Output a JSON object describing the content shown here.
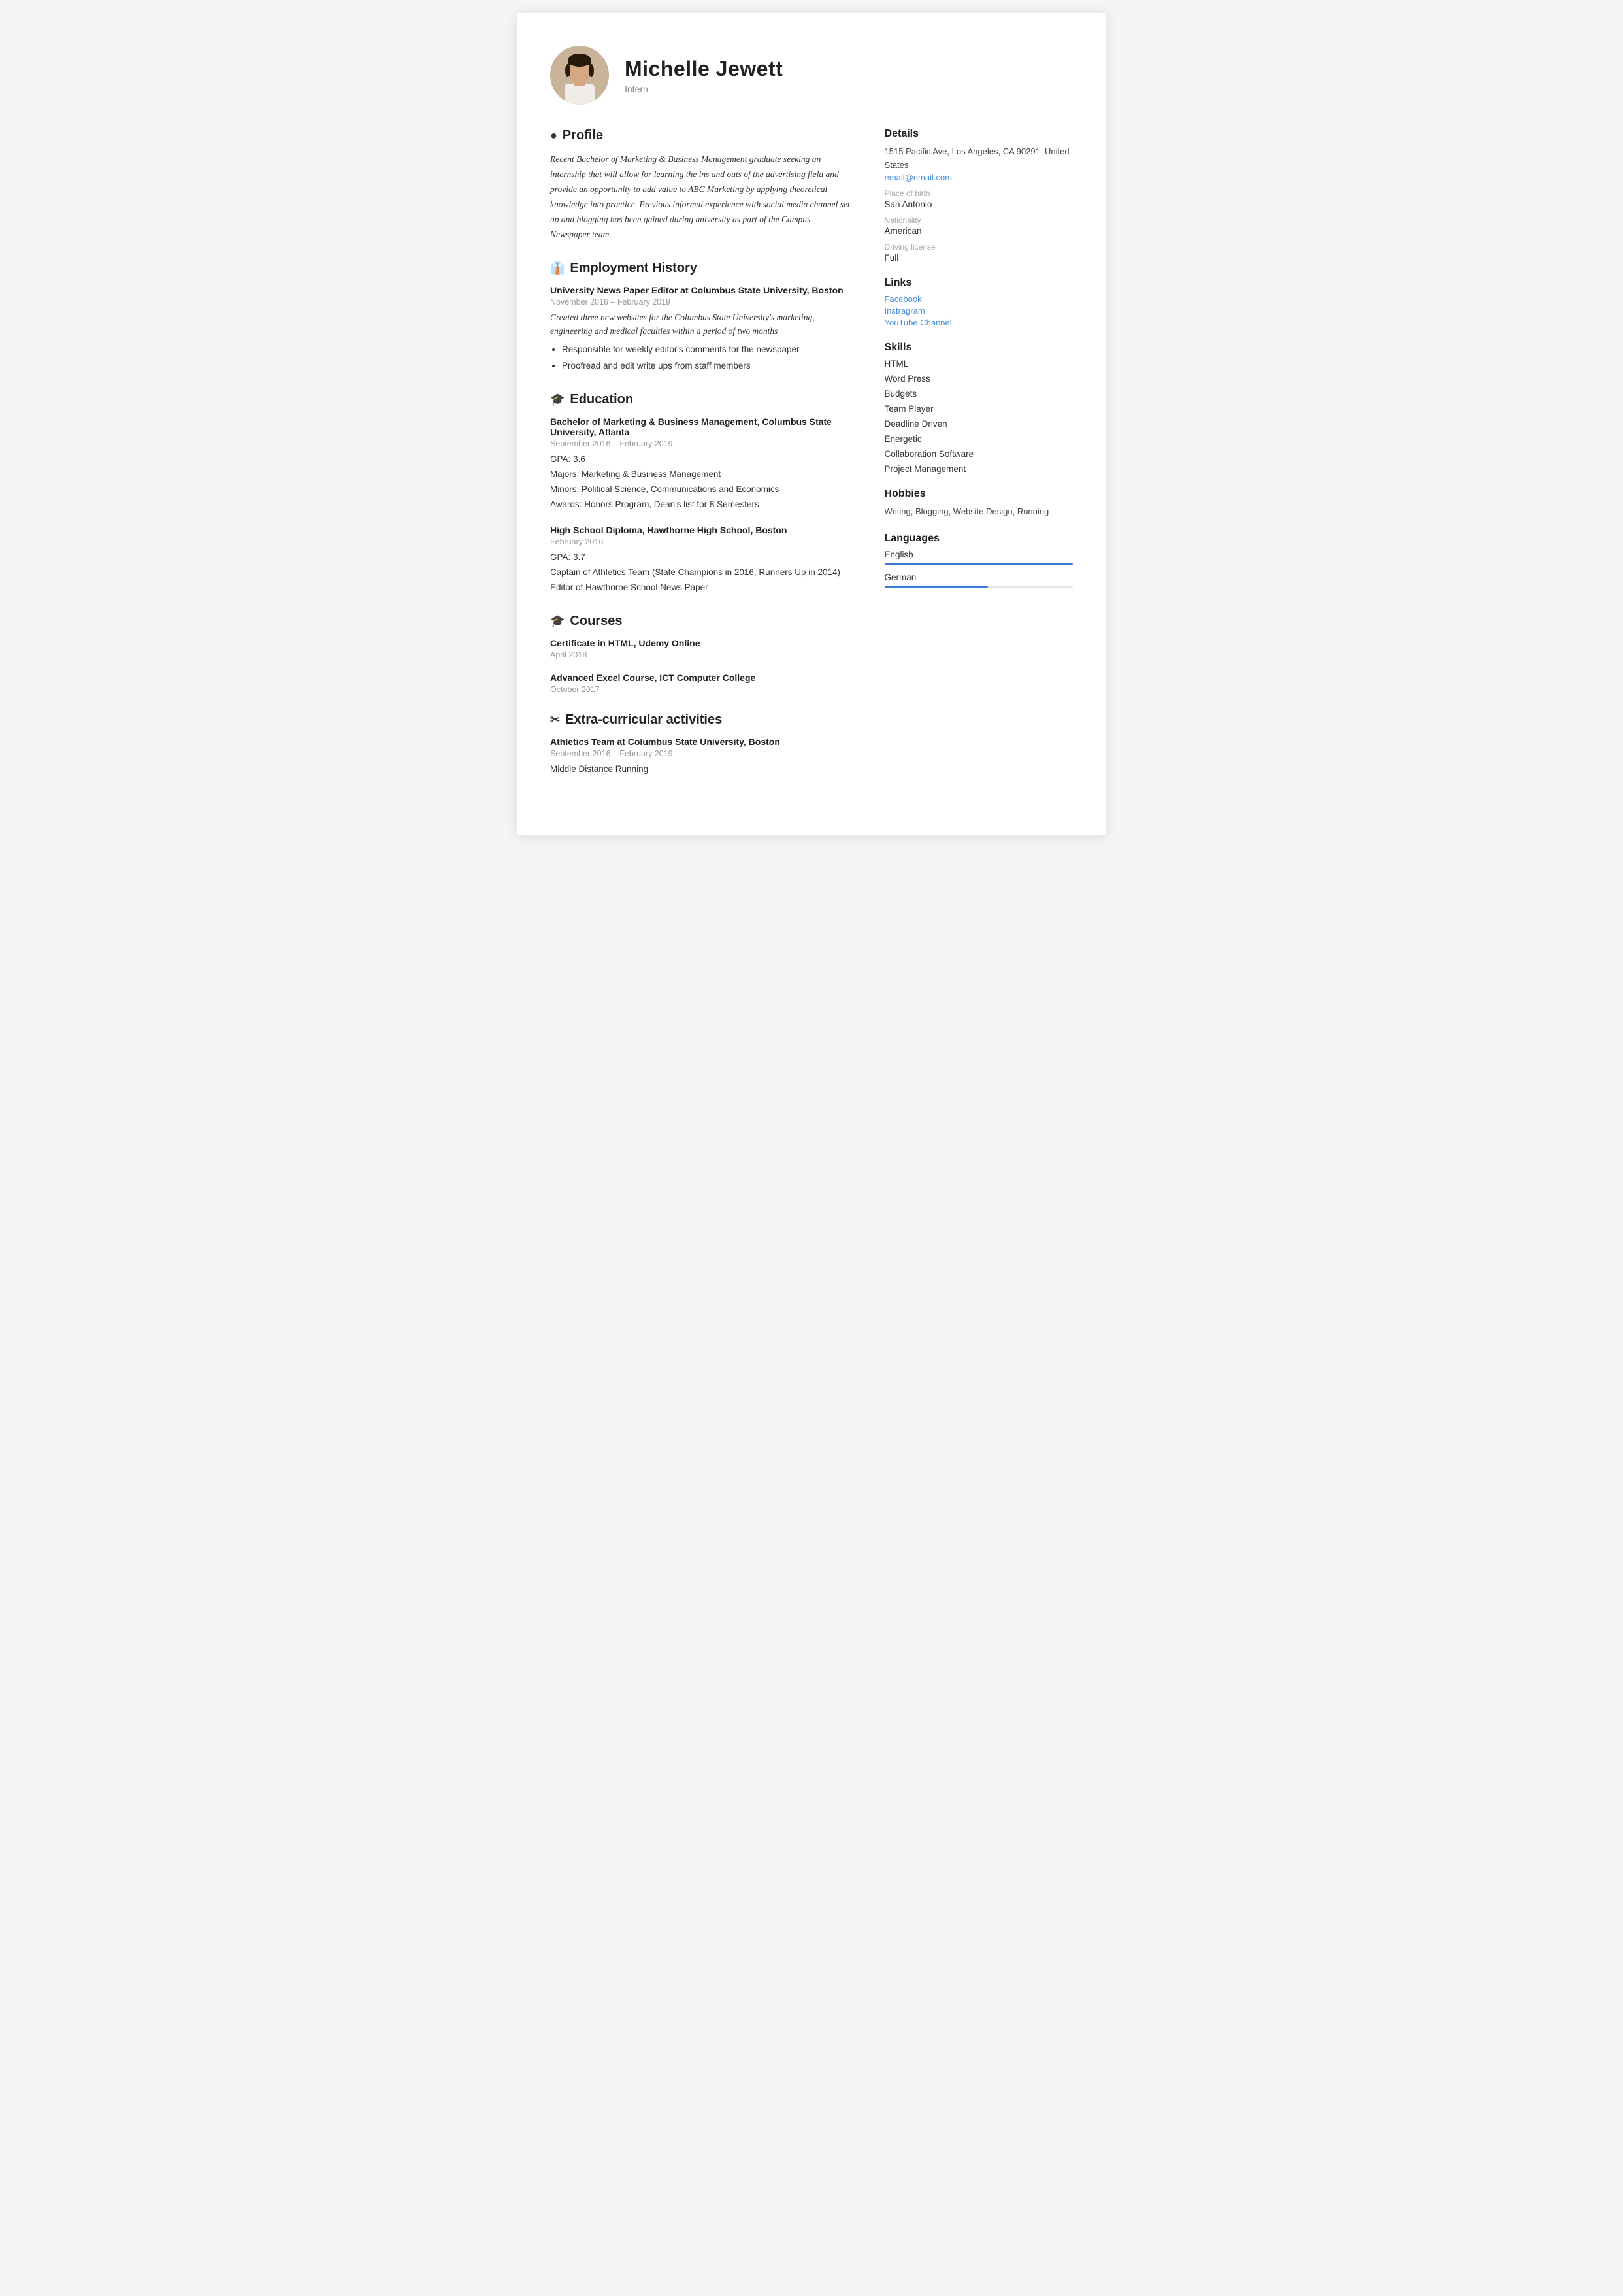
{
  "header": {
    "name": "Michelle Jewett",
    "title": "Intern"
  },
  "profile": {
    "section_label": "Profile",
    "icon": "👤",
    "text": "Recent Bachelor of Marketing & Business Management graduate seeking an internship that will allow for learning the ins and outs of the advertising field and provide an opportunity to add value to ABC Marketing by applying theoretical knowledge into practice. Previous informal experience with social media channel set up and blogging has been gained during university as part of the Campus Newspaper team."
  },
  "employment": {
    "section_label": "Employment History",
    "icon": "💼",
    "items": [
      {
        "title": "University News Paper Editor at Columbus State University, Boston",
        "date": "November 2016 – February 2019",
        "desc": "Created three new websites for the Columbus State University's marketing, engineering and medical faculties within a period of two months",
        "bullets": [
          "Responsible for weekly editor's comments for the newspaper",
          "Proofread and edit write ups from staff members"
        ]
      }
    ]
  },
  "education": {
    "section_label": "Education",
    "icon": "🎓",
    "items": [
      {
        "title": "Bachelor of Marketing & Business Management, Columbus State University, Atlanta",
        "date": "September 2016 – February 2019",
        "details": [
          "GPA: 3.6",
          "Majors: Marketing & Business Management",
          "Minors: Political Science, Communications and Economics",
          "Awards: Honors Program, Dean's list for 8 Semesters"
        ]
      },
      {
        "title": "High School Diploma, Hawthorne High School, Boston",
        "date": "February 2016",
        "details": [
          "GPA: 3.7",
          "Captain of Athletics Team (State Champions in 2016, Runners Up in 2014)",
          "Editor of Hawthorne School News Paper"
        ]
      }
    ]
  },
  "courses": {
    "section_label": "Courses",
    "icon": "🎓",
    "items": [
      {
        "title": "Certificate in HTML, Udemy Online",
        "date": "April 2018"
      },
      {
        "title": "Advanced Excel Course, ICT Computer College",
        "date": "October 2017"
      }
    ]
  },
  "extracurricular": {
    "section_label": "Extra-curricular activities",
    "icon": "✂",
    "items": [
      {
        "title": "Athletics Team at Columbus State University, Boston",
        "date": "September 2016 – February 2019",
        "details": [
          "Middle Distance Running"
        ]
      }
    ]
  },
  "details": {
    "section_label": "Details",
    "address": "1515 Pacific Ave, Los Angeles, CA 90291, United States",
    "email": "email@email.com",
    "place_of_birth_label": "Place of birth",
    "place_of_birth": "San Antonio",
    "nationality_label": "Nationality",
    "nationality": "American",
    "driving_license_label": "Driving license",
    "driving_license": "Full"
  },
  "links": {
    "section_label": "Links",
    "items": [
      {
        "label": "Facebook"
      },
      {
        "label": "Instragram"
      },
      {
        "label": "YouTube Channel"
      }
    ]
  },
  "skills": {
    "section_label": "Skills",
    "items": [
      "HTML",
      "Word Press",
      "Budgets",
      "Team Player",
      "Deadline Driven",
      "Energetic",
      "Collaboration Software",
      "Project Management"
    ]
  },
  "hobbies": {
    "section_label": "Hobbies",
    "text": "Writing, Blogging, Website Design, Running"
  },
  "languages": {
    "section_label": "Languages",
    "items": [
      {
        "name": "English",
        "level": 100
      },
      {
        "name": "German",
        "level": 55
      }
    ]
  }
}
